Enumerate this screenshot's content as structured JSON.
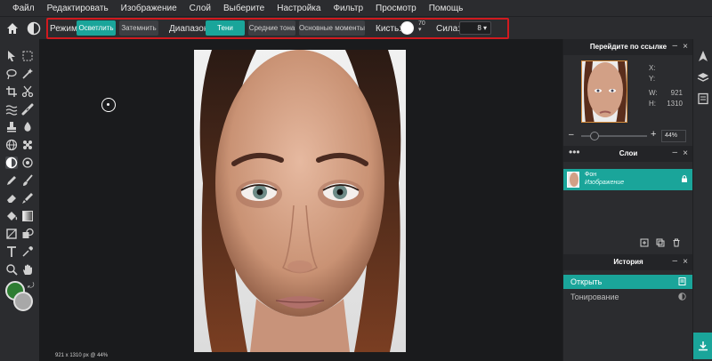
{
  "menu": [
    "Файл",
    "Редактировать",
    "Изображение",
    "Слой",
    "Выберите",
    "Настройка",
    "Фильтр",
    "Просмотр",
    "Помощь"
  ],
  "options": {
    "mode_label": "Режим:",
    "mode_lighten": "Осветлить",
    "mode_darken": "Затемнить",
    "range_label": "Диапазон:",
    "range_shadows": "Тени",
    "range_midtones": "Средние тона",
    "range_highlights": "Основные моменты",
    "brush_label": "Кисть:",
    "brush_size": "70",
    "strength_label": "Сила:",
    "strength_value": "8 ▾"
  },
  "navigator": {
    "title": "Перейдите по ссылке",
    "x_label": "X:",
    "y_label": "Y:",
    "w_label": "W:",
    "w_value": "921",
    "h_label": "H:",
    "h_value": "1310",
    "zoom_minus": "–",
    "zoom_plus": "+",
    "zoom_value": "44%"
  },
  "layers": {
    "title": "Слои",
    "items": [
      {
        "name": "Фон",
        "type": "Изображение"
      }
    ]
  },
  "history": {
    "title": "История",
    "items": [
      {
        "label": "Открыть",
        "active": true
      },
      {
        "label": "Тонирование",
        "active": false
      }
    ]
  },
  "status": "921 x 1310 px @ 44%",
  "colors": {
    "accent": "#1aa59a",
    "foreground": "#2e7d32",
    "background": "#a8a8a8",
    "highlight_border": "#d11a1f"
  }
}
